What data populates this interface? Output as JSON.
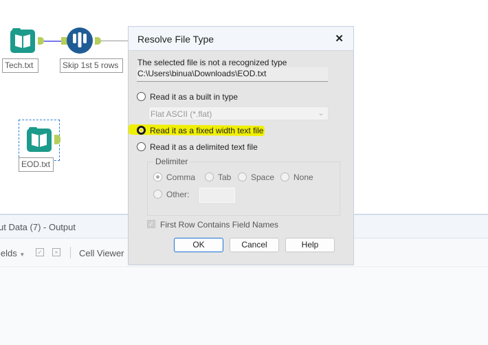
{
  "canvas": {
    "tools": [
      {
        "label": "Tech.txt",
        "icon": "book-icon"
      },
      {
        "label": "Skip 1st 5 rows",
        "icon": "sample-tubes-icon"
      },
      {
        "label": "EOD.txt",
        "icon": "book-icon"
      }
    ]
  },
  "results_panel": {
    "title": "ut Data (7) - Output",
    "fields_label": "ields",
    "cell_viewer_label": "Cell Viewer"
  },
  "dialog": {
    "title": "Resolve File Type",
    "message": "The selected file is not a recognized type",
    "file_path": "C:\\Users\\binua\\Downloads\\EOD.txt",
    "options": [
      {
        "label": "Read it as a built in type",
        "selected": false
      },
      {
        "label": "Read it as a fixed width text file",
        "selected": true
      },
      {
        "label": "Read it as a delimited text file",
        "selected": false
      }
    ],
    "builtin_type_value": "Flat ASCII (*.flat)",
    "delimiter": {
      "legend": "Delimiter",
      "options": [
        "Comma",
        "Tab",
        "Space",
        "None"
      ],
      "other_label": "Other:",
      "other_value": ""
    },
    "first_row_label": "First Row Contains Field Names",
    "first_row_checked": true,
    "buttons": {
      "ok": "OK",
      "cancel": "Cancel",
      "help": "Help"
    }
  },
  "colors": {
    "highlight": "#f0ef00",
    "tool_teal": "#1c9a8b",
    "tool_blue": "#1f5c96",
    "connector": "#b5cf5a"
  }
}
